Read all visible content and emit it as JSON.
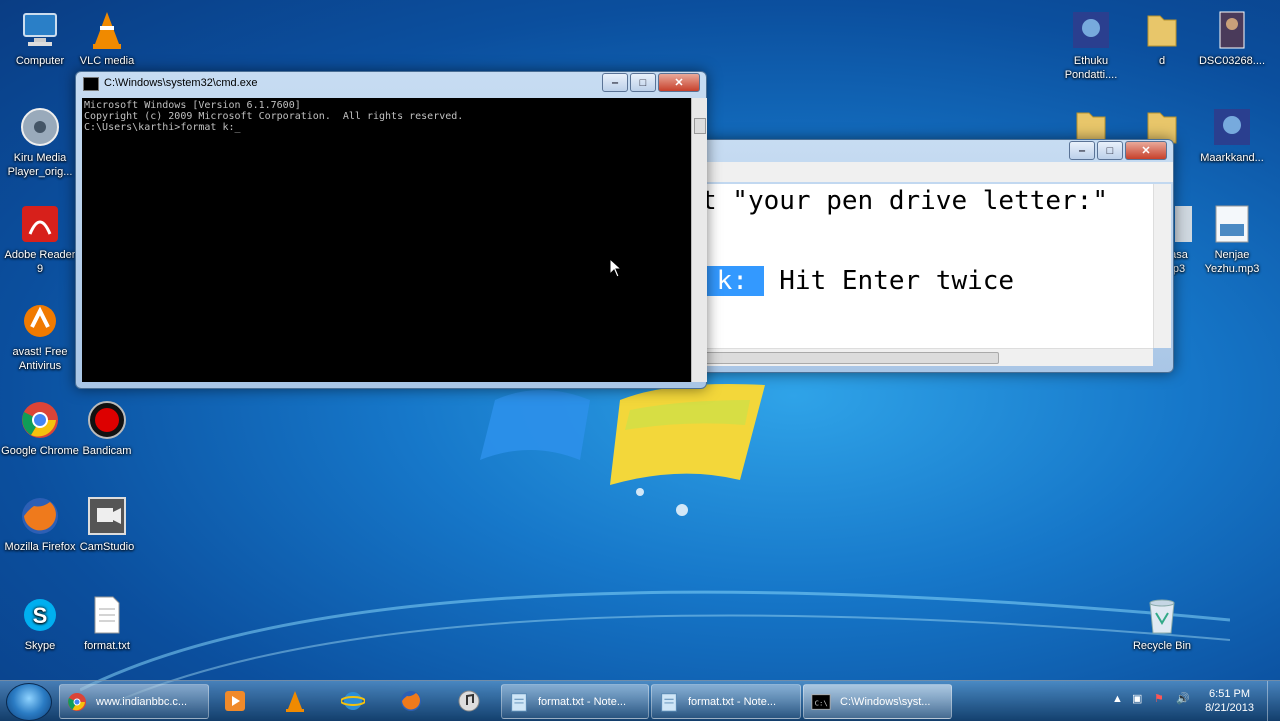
{
  "desktop_icons_left": [
    {
      "label": "Computer",
      "icon": "computer-icon"
    },
    {
      "label": "VLC media",
      "icon": "vlc-icon"
    },
    {
      "label": "Kiru Media Player_orig...",
      "icon": "media-player-icon"
    },
    {
      "label": "Adobe Reader 9",
      "icon": "adobe-reader-icon"
    },
    {
      "label": "avast! Free Antivirus",
      "icon": "avast-icon"
    },
    {
      "label": "Google Chrome",
      "icon": "chrome-icon"
    },
    {
      "label": "Bandicam",
      "icon": "bandicam-icon"
    },
    {
      "label": "Mozilla Firefox",
      "icon": "firefox-icon"
    },
    {
      "label": "CamStudio",
      "icon": "camstudio-icon"
    },
    {
      "label": "Skype",
      "icon": "skype-icon"
    },
    {
      "label": "format.txt",
      "icon": "text-file-icon"
    }
  ],
  "desktop_icons_right": [
    {
      "label": "Ethuku Pondatti....",
      "icon": "movie-icon"
    },
    {
      "label": "d",
      "icon": "folder-icon"
    },
    {
      "label": "DSC03268....",
      "icon": "photo-icon"
    },
    {
      "label": "Maarkkand...",
      "icon": "movie-icon"
    },
    {
      "label": "asa p3",
      "icon": "audio-file-icon"
    },
    {
      "label": "Nenjae Yezhu.mp3",
      "icon": "audio-file-icon"
    },
    {
      "label": "Recycle Bin",
      "icon": "recycle-bin-icon"
    }
  ],
  "cmd_window": {
    "title": "C:\\Windows\\system32\\cmd.exe",
    "lines": [
      "Microsoft Windows [Version 6.1.7600]",
      "Copyright (c) 2009 Microsoft Corporation.  All rights reserved.",
      "",
      "C:\\Users\\karthi>format k:_"
    ]
  },
  "notepad_window": {
    "line1": "t \"your pen drive letter:\"",
    "selected": " k: ",
    "line2_rest": " Hit Enter twice"
  },
  "taskbar": {
    "items": [
      {
        "label": "www.indianbbc.c...",
        "icon": "chrome-icon"
      },
      {
        "label": "format.txt - Note...",
        "icon": "notepad-icon"
      },
      {
        "label": "format.txt - Note...",
        "icon": "notepad-icon"
      },
      {
        "label": "C:\\Windows\\syst...",
        "icon": "cmd-icon"
      }
    ],
    "time": "6:51 PM",
    "date": "8/21/2013"
  }
}
